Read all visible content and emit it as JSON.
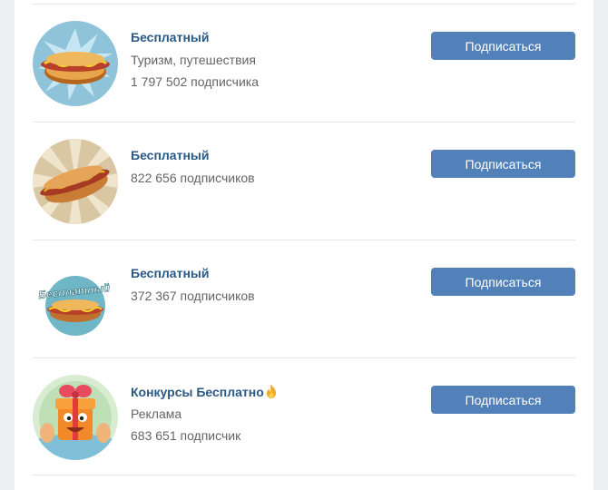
{
  "button_label": "Подписаться",
  "communities": [
    {
      "name": "Бесплатный",
      "lines": [
        "Туризм, путешествия",
        "1 797 502 подписчика"
      ],
      "avatar": "hotdog-blue-burst"
    },
    {
      "name": "Бесплатный",
      "lines": [
        "822 656 подписчиков"
      ],
      "avatar": "hotdog-sunburst"
    },
    {
      "name": "Бесплатный",
      "lines": [
        "372 367 подписчиков"
      ],
      "avatar": "hotdog-logo"
    },
    {
      "name": "Конкурсы Бесплатно",
      "name_icon": "fire-icon",
      "lines": [
        "Реклама",
        "683 651 подписчик"
      ],
      "avatar": "gift-character"
    }
  ],
  "colors": {
    "link": "#2a5885",
    "button": "#5181b8",
    "muted": "#656565",
    "divider": "#e7e8ec",
    "background": "#edeef0"
  },
  "avatars": {
    "logo_text": "Бесплатный"
  }
}
